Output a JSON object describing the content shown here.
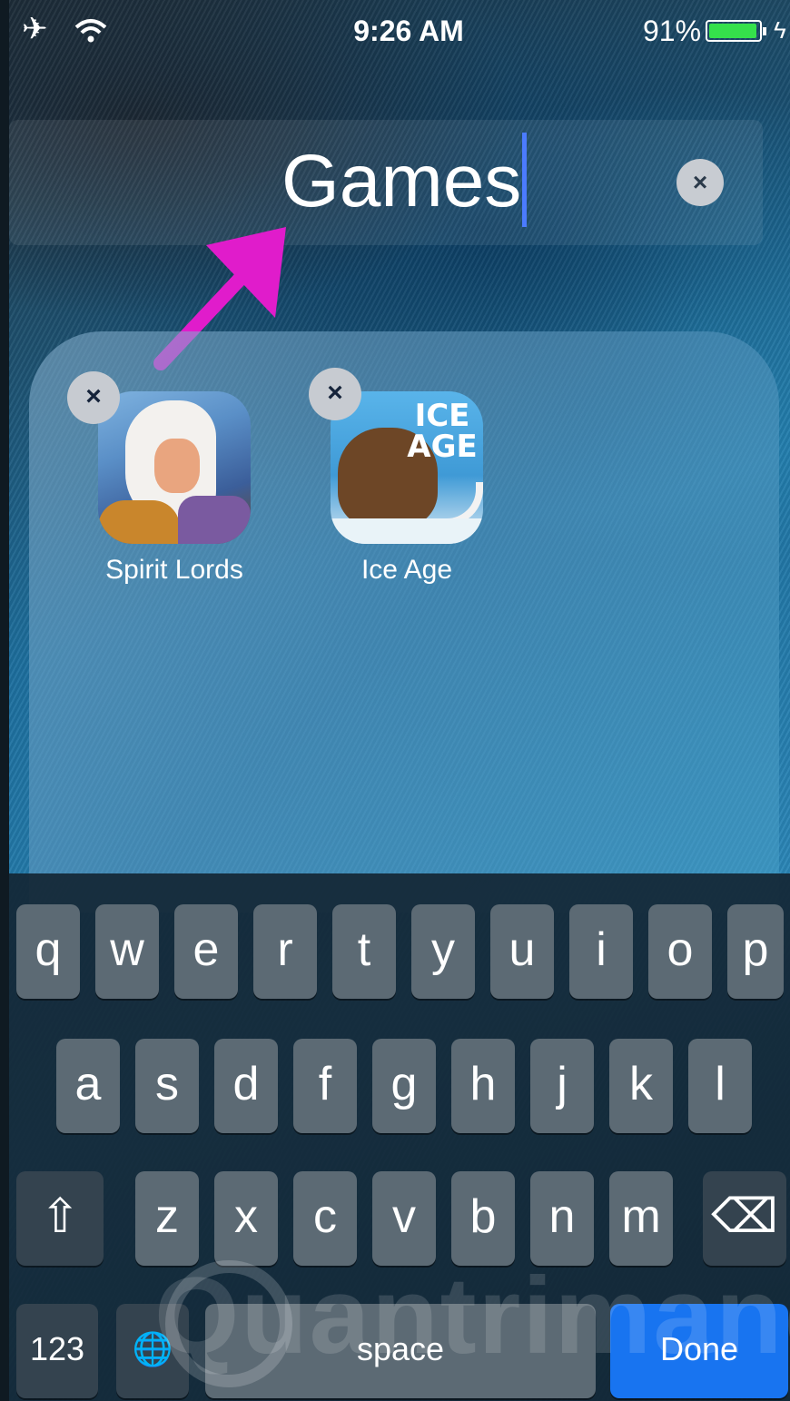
{
  "status_bar": {
    "airplane_icon": "airplane-icon",
    "wifi_icon": "wifi-icon",
    "time": "9:26 AM",
    "battery_percent": "91%",
    "battery_level": 0.91,
    "battery_color": "#35e04b"
  },
  "folder": {
    "name": "Games",
    "clear_icon": "×",
    "apps": [
      {
        "label": "Spirit Lords",
        "delete_icon": "×"
      },
      {
        "label": "Ice Age",
        "delete_icon": "×",
        "icon_text": "ICE AGE"
      }
    ]
  },
  "keyboard": {
    "row1": [
      "q",
      "w",
      "e",
      "r",
      "t",
      "y",
      "u",
      "i",
      "o",
      "p"
    ],
    "row2": [
      "a",
      "s",
      "d",
      "f",
      "g",
      "h",
      "j",
      "k",
      "l"
    ],
    "row3": [
      "z",
      "x",
      "c",
      "v",
      "b",
      "n",
      "m"
    ],
    "shift_icon": "⇧",
    "delete_icon": "⌫",
    "numbers_label": "123",
    "globe_icon": "🌐",
    "space_label": "space",
    "done_label": "Done",
    "done_color": "#1874f0"
  },
  "watermark": "Quantrimang"
}
